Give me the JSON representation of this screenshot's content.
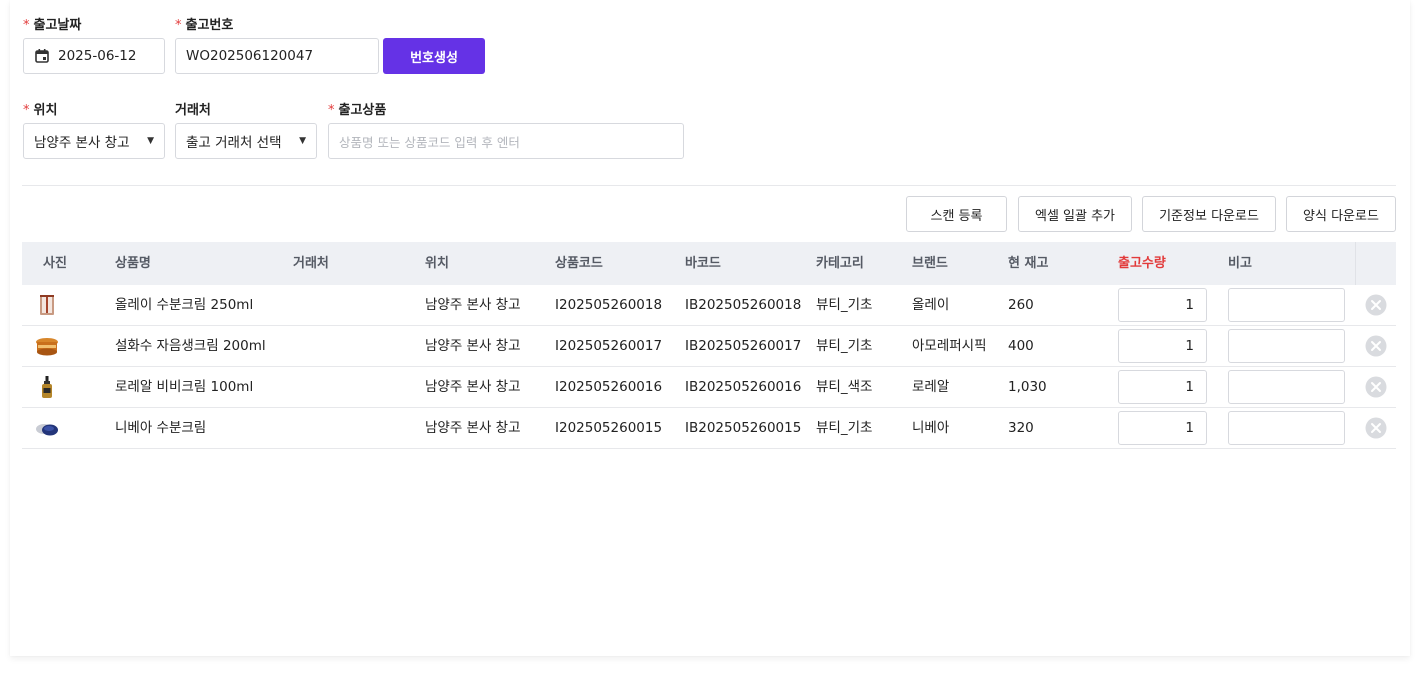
{
  "form": {
    "date_label": "출고날짜",
    "date_value": "2025-06-12",
    "number_label": "출고번호",
    "number_value": "WO202506120047",
    "generate_button": "번호생성",
    "location_label": "위치",
    "location_value": "남양주 본사 창고",
    "partner_label": "거래처",
    "partner_value": "출고 거래처 선택",
    "product_label": "출고상품",
    "product_placeholder": "상품명 또는 상품코드 입력 후 엔터",
    "required_mark": "*"
  },
  "actions": {
    "scan": "스캔 등록",
    "excel": "엑셀 일괄 추가",
    "master_download": "기준정보 다운로드",
    "template_download": "양식 다운로드"
  },
  "table": {
    "headers": {
      "photo": "사진",
      "name": "상품명",
      "partner": "거래처",
      "location": "위치",
      "code": "상품코드",
      "barcode": "바코드",
      "category": "카테고리",
      "brand": "브랜드",
      "stock": "현 재고",
      "qty": "출고수량",
      "memo": "비고"
    },
    "rows": [
      {
        "thumb_icon": "cream-box-icon",
        "name": "올레이 수분크림 250ml",
        "partner": "",
        "location": "남양주 본사 창고",
        "code": "I202505260018",
        "barcode": "IB202505260018",
        "category": "뷰티_기초",
        "brand": "올레이",
        "stock": "260",
        "qty": "1",
        "memo": ""
      },
      {
        "thumb_icon": "cream-jar-icon",
        "name": "설화수 자음생크림 200ml",
        "partner": "",
        "location": "남양주 본사 창고",
        "code": "I202505260017",
        "barcode": "IB202505260017",
        "category": "뷰티_기초",
        "brand": "아모레퍼시픽",
        "stock": "400",
        "qty": "1",
        "memo": ""
      },
      {
        "thumb_icon": "serum-bottle-icon",
        "name": "로레알 비비크림 100ml",
        "partner": "",
        "location": "남양주 본사 창고",
        "code": "I202505260016",
        "barcode": "IB202505260016",
        "category": "뷰티_색조",
        "brand": "로레알",
        "stock": "1,030",
        "qty": "1",
        "memo": ""
      },
      {
        "thumb_icon": "cream-tin-icon",
        "name": "니베아 수분크림",
        "partner": "",
        "location": "남양주 본사 창고",
        "code": "I202505260015",
        "barcode": "IB202505260015",
        "category": "뷰티_기초",
        "brand": "니베아",
        "stock": "320",
        "qty": "1",
        "memo": ""
      }
    ]
  },
  "colors": {
    "primary": "#6532e6",
    "required": "#e23b3b",
    "header_bg": "#eef0f4"
  }
}
